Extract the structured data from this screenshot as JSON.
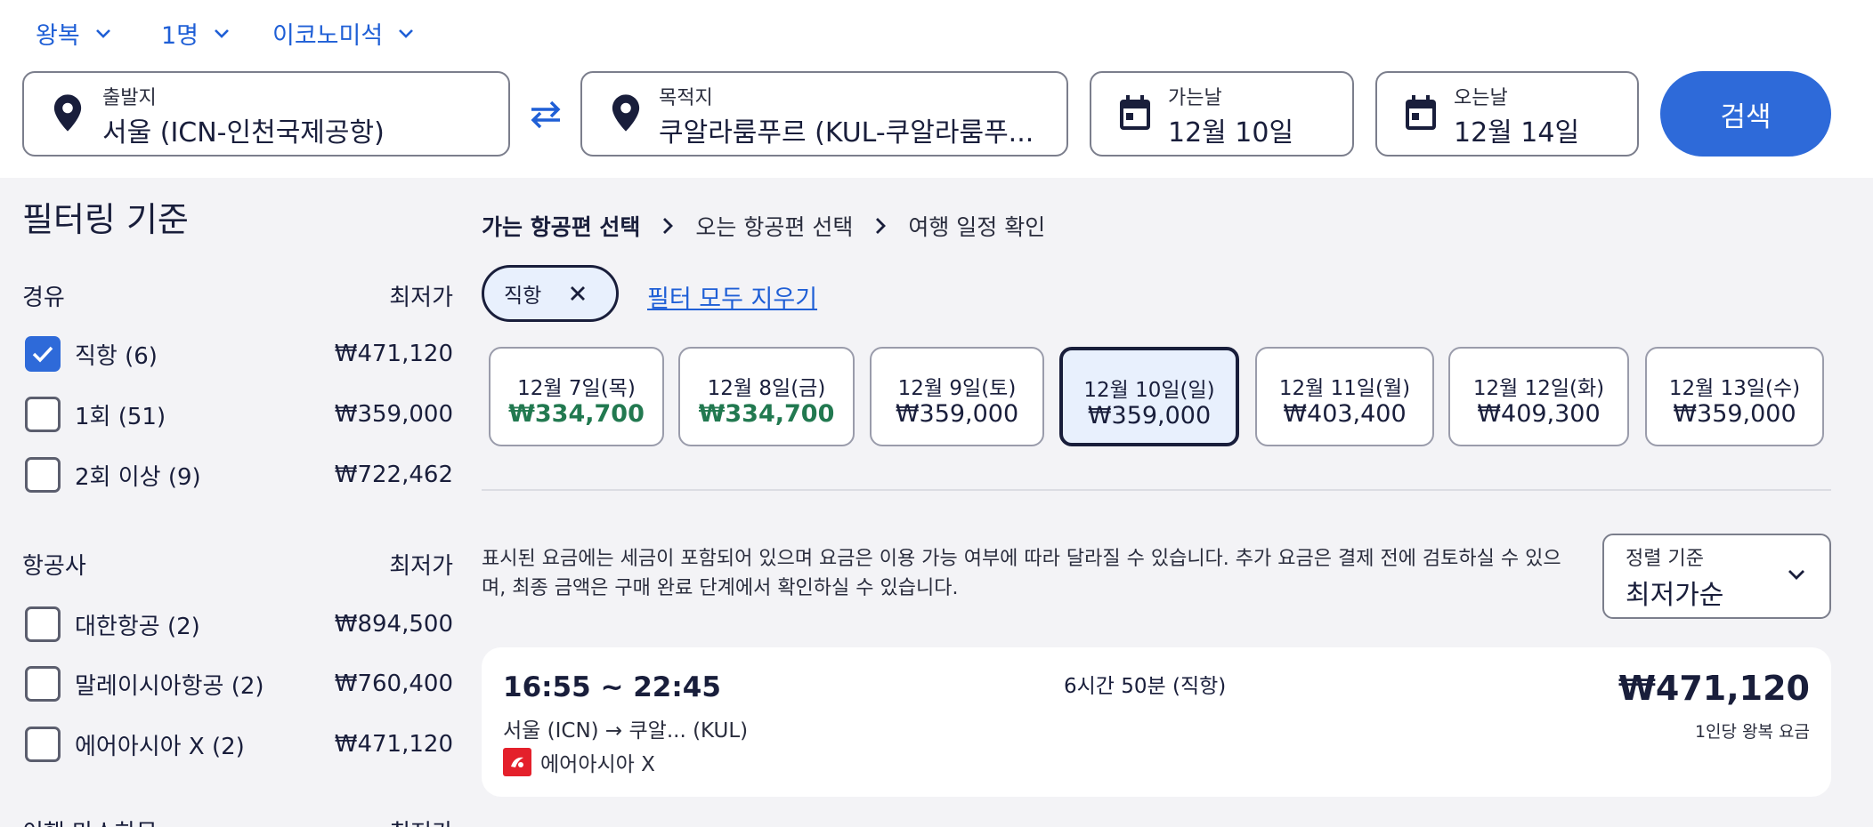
{
  "trip_options": {
    "trip_type": "왕복",
    "travelers": "1명",
    "cabin": "이코노미석"
  },
  "search": {
    "origin_label": "출발지",
    "origin_value": "서울 (ICN-인천국제공항)",
    "destination_label": "목적지",
    "destination_value": "쿠알라룸푸르 (KUL-쿠알라룸푸...",
    "depart_label": "가는날",
    "depart_value": "12월 10일",
    "return_label": "오는날",
    "return_value": "12월 14일",
    "button_label": "검색"
  },
  "filters": {
    "title": "필터링 기준",
    "stops": {
      "heading": "경유",
      "price_heading": "최저가",
      "options": [
        {
          "label": "직항 (6)",
          "price": "₩471,120",
          "checked": true
        },
        {
          "label": "1회 (51)",
          "price": "₩359,000",
          "checked": false
        },
        {
          "label": "2회 이상 (9)",
          "price": "₩722,462",
          "checked": false
        }
      ]
    },
    "airlines": {
      "heading": "항공사",
      "price_heading": "최저가",
      "options": [
        {
          "label": "대한항공 (2)",
          "price": "₩894,500",
          "checked": false
        },
        {
          "label": "말레이시아항공 (2)",
          "price": "₩760,400",
          "checked": false
        },
        {
          "label": "에어아시아 X (2)",
          "price": "₩471,120",
          "checked": false
        }
      ]
    },
    "next_heading_partial": "이핸 마스하무",
    "next_price_partial": "최저가"
  },
  "breadcrumb": {
    "step1": "가는 항공편 선택",
    "step2": "오는 항공편 선택",
    "step3": "여행 일정 확인"
  },
  "active_filter": {
    "chip_label": "직항",
    "clear_all": "필터 모두 지우기"
  },
  "dates": [
    {
      "label": "12월 7일(목)",
      "price": "₩334,700",
      "lowest": true,
      "selected": false
    },
    {
      "label": "12월 8일(금)",
      "price": "₩334,700",
      "lowest": true,
      "selected": false
    },
    {
      "label": "12월 9일(토)",
      "price": "₩359,000",
      "lowest": false,
      "selected": false
    },
    {
      "label": "12월 10일(일)",
      "price": "₩359,000",
      "lowest": false,
      "selected": true
    },
    {
      "label": "12월 11일(월)",
      "price": "₩403,400",
      "lowest": false,
      "selected": false
    },
    {
      "label": "12월 12일(화)",
      "price": "₩409,300",
      "lowest": false,
      "selected": false
    },
    {
      "label": "12월 13일(수)",
      "price": "₩359,000",
      "lowest": false,
      "selected": false
    }
  ],
  "notice": "표시된 요금에는 세금이 포함되어 있으며 요금은 이용 가능 여부에 따라 달라질 수 있습니다. 추가 요금은 결제 전에 검토하실 수 있으며, 최종 금액은 구매 완료 단계에서 확인하실 수 있습니다.",
  "sort": {
    "label": "정렬 기준",
    "value": "최저가순"
  },
  "result": {
    "time": "16:55 ~ 22:45",
    "duration": "6시간 50분 (직항)",
    "route": "서울 (ICN) → 쿠알... (KUL)",
    "airline": "에어아시아 X",
    "price": "₩471,120",
    "price_note": "1인당 왕복 요금"
  },
  "colors": {
    "accent": "#2e6ad9",
    "link": "#1f5fd6",
    "low_price": "#227950",
    "text": "#191e3b"
  }
}
